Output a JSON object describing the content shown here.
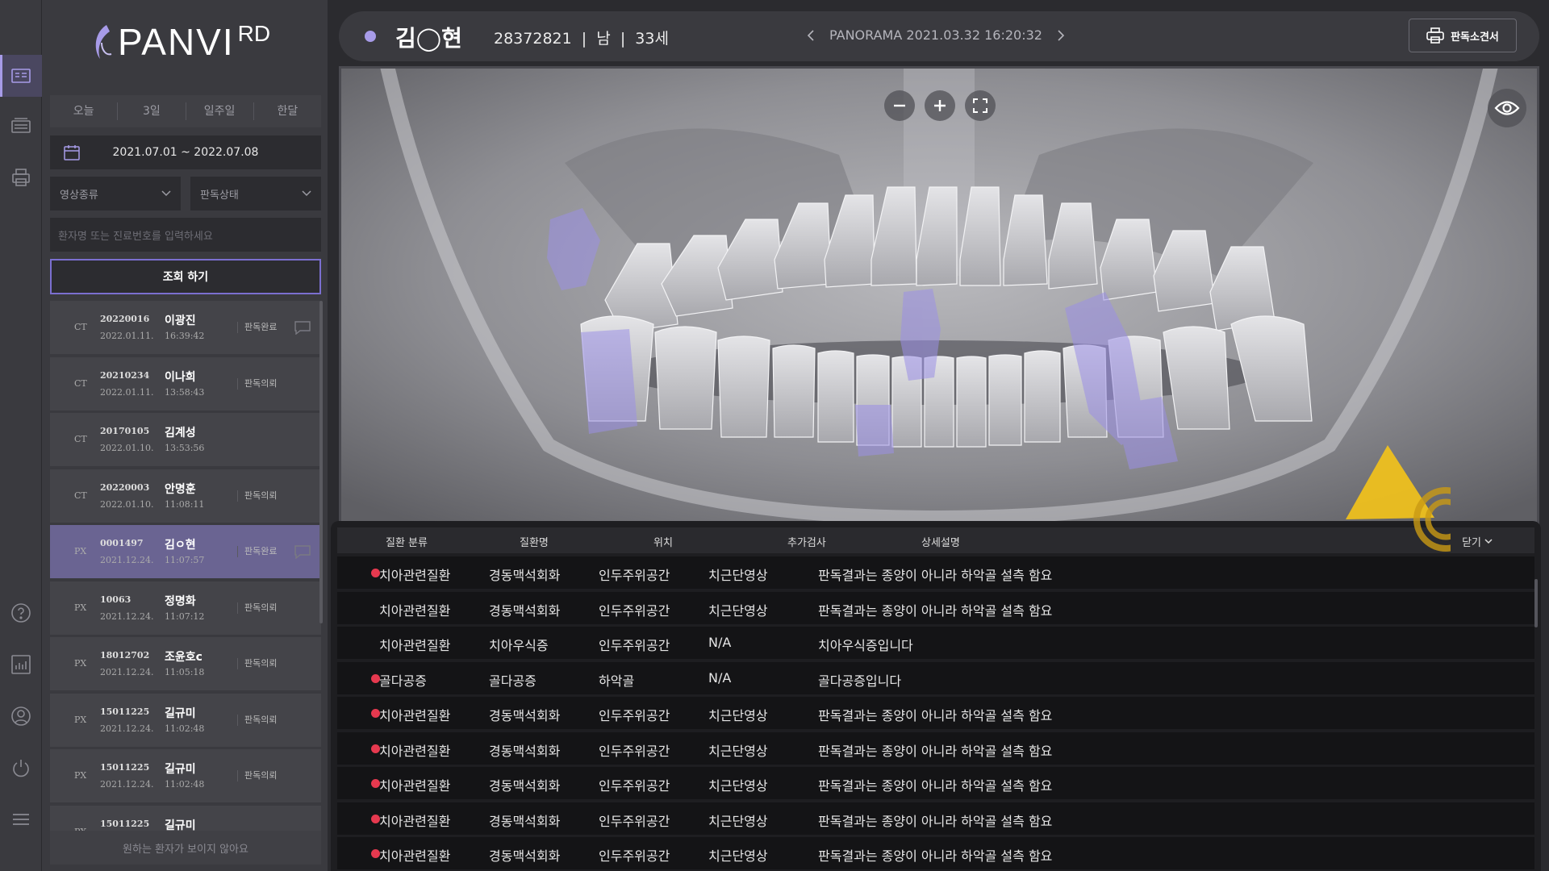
{
  "app": {
    "brand": "PANVI",
    "brand_sup": "RD"
  },
  "period_tabs": [
    "오늘",
    "3일",
    "일주일",
    "한달"
  ],
  "date_range": "2021.07.01 ~ 2022.07.08",
  "filters": {
    "image_type": "영상종류",
    "read_status": "판독상태"
  },
  "search": {
    "placeholder": "환자명 또는 진료번호를 입력하세요"
  },
  "query_button": "조회 하기",
  "patients": [
    {
      "modality": "CT",
      "id": "20220016",
      "date": "2022.01.11.",
      "name": "이광진",
      "time": "16:39:42",
      "status": "판독완료",
      "message": true
    },
    {
      "modality": "CT",
      "id": "20210234",
      "date": "2022.01.11.",
      "name": "이나희",
      "time": "13:58:43",
      "status": "판독의뢰",
      "message": false
    },
    {
      "modality": "CT",
      "id": "20170105",
      "date": "2022.01.10.",
      "name": "김계성",
      "time": "13:53:56",
      "status": "",
      "message": false
    },
    {
      "modality": "CT",
      "id": "20220003",
      "date": "2022.01.10.",
      "name": "안명훈",
      "time": "11:08:11",
      "status": "판독의뢰",
      "message": false
    },
    {
      "modality": "PX",
      "id": "0001497",
      "date": "2021.12.24.",
      "name": "김ㅇ현",
      "time": "11:07:57",
      "status": "판독완료",
      "message": true,
      "selected": true
    },
    {
      "modality": "PX",
      "id": "10063",
      "date": "2021.12.24.",
      "name": "정명화",
      "time": "11:07:12",
      "status": "판독의뢰",
      "message": false
    },
    {
      "modality": "PX",
      "id": "18012702",
      "date": "2021.12.24.",
      "name": "조윤호c",
      "time": "11:05:18",
      "status": "판독의뢰",
      "message": false
    },
    {
      "modality": "PX",
      "id": "15011225",
      "date": "2021.12.24.",
      "name": "길규미",
      "time": "11:02:48",
      "status": "판독의뢰",
      "message": false
    },
    {
      "modality": "PX",
      "id": "15011225",
      "date": "2021.12.24.",
      "name": "길규미",
      "time": "11:02:48",
      "status": "판독의뢰",
      "message": false
    },
    {
      "modality": "PX",
      "id": "15011225",
      "date": "",
      "name": "길규미",
      "time": "",
      "status": "",
      "message": false
    }
  ],
  "missing_link": "원하는 환자가 보이지 않아요",
  "header": {
    "name": "김◯현",
    "info": "28372821  |  남  |  33세",
    "study": "PANORAMA 2021.03.32 16:20:32",
    "print_label": "판독소견서"
  },
  "findings": {
    "columns": [
      "질환 분류",
      "질환명",
      "위치",
      "추가검사",
      "상세설명"
    ],
    "close_label": "닫기",
    "rows": [
      {
        "dot": true,
        "category": "치아관련질환",
        "disease": "경동맥석회화",
        "location": "인두주위공간",
        "exam": "치근단영상",
        "detail": "판독결과는 종양이 아니라 하악골 설측 함요"
      },
      {
        "dot": false,
        "category": "치아관련질환",
        "disease": "경동맥석회화",
        "location": "인두주위공간",
        "exam": "치근단영상",
        "detail": "판독결과는 종양이 아니라 하악골 설측 함요"
      },
      {
        "dot": false,
        "category": "치아관련질환",
        "disease": "치아우식증",
        "location": "인두주위공간",
        "exam": "N/A",
        "detail": "치아우식증입니다"
      },
      {
        "dot": true,
        "category": "골다공증",
        "disease": "골다공증",
        "location": "하악골",
        "exam": "N/A",
        "detail": "골다공증입니다"
      },
      {
        "dot": true,
        "category": "치아관련질환",
        "disease": "경동맥석회화",
        "location": "인두주위공간",
        "exam": "치근단영상",
        "detail": "판독결과는 종양이 아니라 하악골 설측 함요"
      },
      {
        "dot": true,
        "category": "치아관련질환",
        "disease": "경동맥석회화",
        "location": "인두주위공간",
        "exam": "치근단영상",
        "detail": "판독결과는 종양이 아니라 하악골 설측 함요"
      },
      {
        "dot": true,
        "category": "치아관련질환",
        "disease": "경동맥석회화",
        "location": "인두주위공간",
        "exam": "치근단영상",
        "detail": "판독결과는 종양이 아니라 하악골 설측 함요"
      },
      {
        "dot": true,
        "category": "치아관련질환",
        "disease": "경동맥석회화",
        "location": "인두주위공간",
        "exam": "치근단영상",
        "detail": "판독결과는 종양이 아니라 하악골 설측 함요"
      },
      {
        "dot": true,
        "category": "치아관련질환",
        "disease": "경동맥석회화",
        "location": "인두주위공간",
        "exam": "치근단영상",
        "detail": "판독결과는 종양이 아니라 하악골 설측 함요"
      }
    ]
  },
  "icons": {
    "rail": [
      "reading-list-icon",
      "image-list-icon",
      "print-icon",
      "help-icon",
      "statistics-icon",
      "user-icon",
      "power-icon",
      "menu-icon"
    ],
    "viewer": [
      "zoom-out-icon",
      "zoom-in-icon",
      "fullscreen-icon",
      "eye-icon"
    ]
  },
  "colors": {
    "accent": "#a79be8",
    "selected_row": "#6a6492",
    "alert_dot": "#e6394f",
    "overlay": "#9b8fe6"
  }
}
